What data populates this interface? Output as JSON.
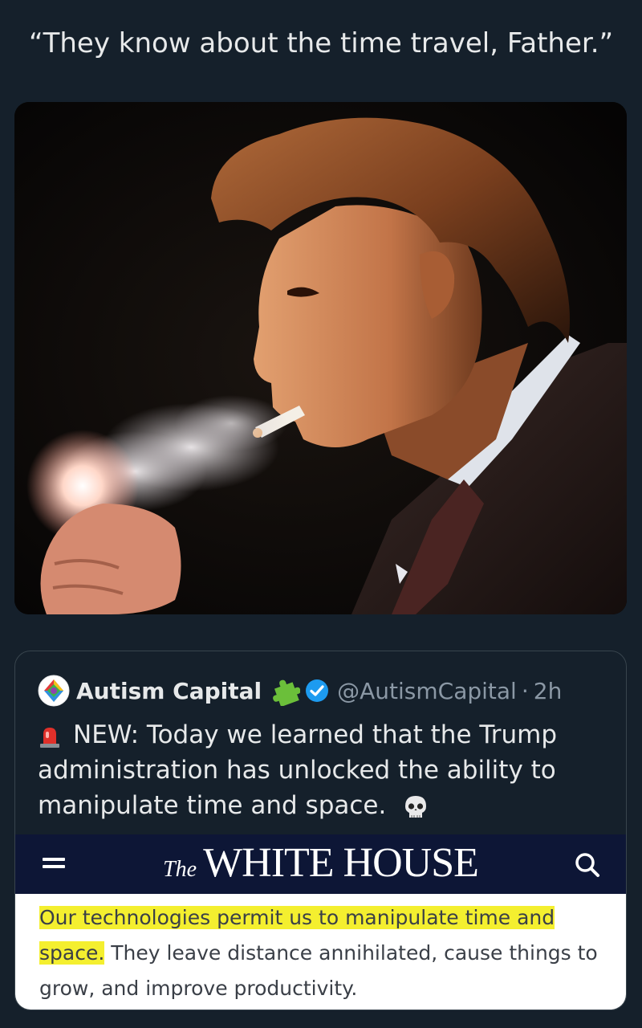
{
  "post": {
    "caption": "“They know about the time travel, Father.”"
  },
  "quoted_post": {
    "author_name": "Autism Capital",
    "author_handle": "@AutismCapital",
    "time_separator": "·",
    "time_ago": "2h",
    "text": "NEW: Today we learned that the Trump administration has unlocked the ability to manipulate time and space.",
    "leading_emoji": "police-light-icon",
    "trailing_emoji": "skull-icon",
    "verified_color": "#1d9bf0"
  },
  "embedded_screenshot": {
    "site_prefix": "The",
    "site_name": "WHITE HOUSE",
    "header_color": "#0d1636",
    "highlight_color": "#f4ef2f",
    "highlighted_text_line1": "Our technologies permit us to manipulate time and",
    "highlighted_text_line2": "space.",
    "body_text": " They leave distance annihilated, cause things to grow, and improve productivity."
  }
}
